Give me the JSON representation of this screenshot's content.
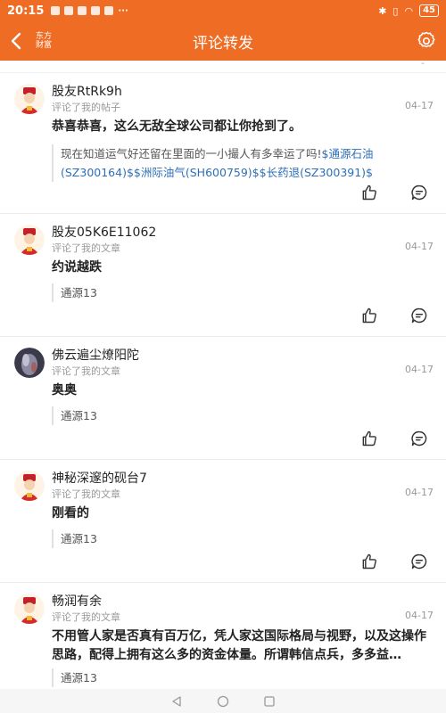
{
  "status": {
    "time": "20:15",
    "battery": "45"
  },
  "header": {
    "title": "评论转发",
    "logo_line1": "东方",
    "logo_line2": "财富"
  },
  "partial_marker": "-",
  "items": [
    {
      "user": "股友RtRk9h",
      "meta": "评论了我的帖子",
      "date": "04-17",
      "text": "恭喜恭喜，这么无敌全球公司都让你抢到了。",
      "quote_plain": "现在知道运气好还留在里面的一小撮人有多幸运了吗!",
      "quote_stocks": "$通源石油(SZ300164)$$洲际油气(SH600759)$$长药退(SZ300391)$"
    },
    {
      "user": "股友05K6E11062",
      "meta": "评论了我的文章",
      "date": "04-17",
      "text": "约说越跌",
      "quote": "通源13"
    },
    {
      "user": "佛云遍尘燎阳陀",
      "meta": "评论了我的文章",
      "date": "04-17",
      "text": "奥奥",
      "quote": "通源13"
    },
    {
      "user": "神秘深邃的砚台7",
      "meta": "评论了我的文章",
      "date": "04-17",
      "text": "刚看的",
      "quote": "通源13"
    },
    {
      "user": "畅润有余",
      "meta": "评论了我的文章",
      "date": "04-17",
      "text": "不用管人家是否真有百万亿，凭人家这国际格局与视野，以及这操作思路，配得上拥有这么多的资金体量。所谓韩信点兵，多多益…",
      "quote": "通源13"
    }
  ],
  "colors": {
    "brand": "#ef6c24",
    "stock_link": "#2f6fb7"
  },
  "icons": [
    "back-icon",
    "settings-icon",
    "like-icon",
    "comment-icon"
  ]
}
